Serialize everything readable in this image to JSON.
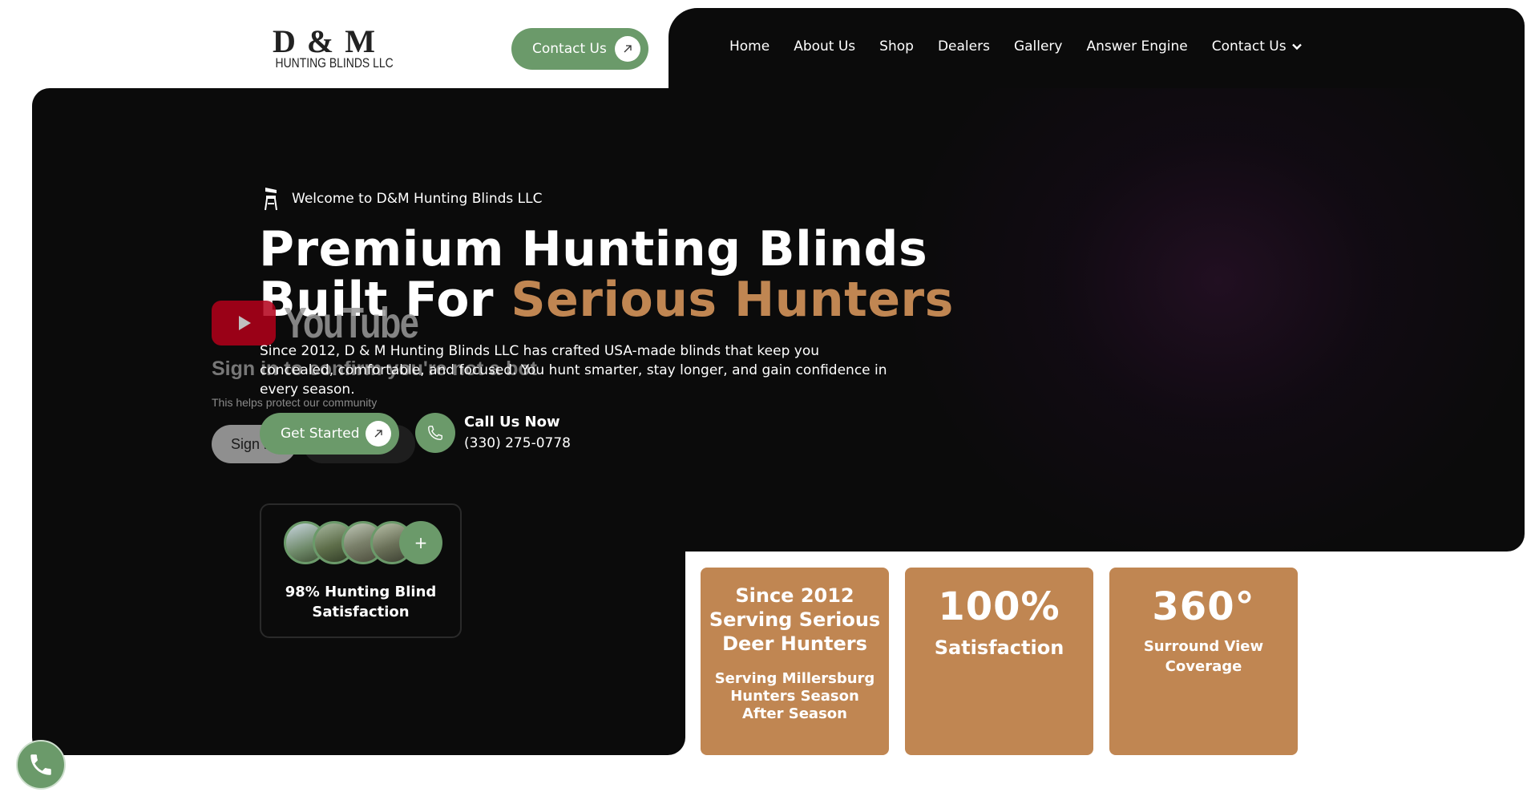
{
  "logo": {
    "main": "D & M",
    "sub": "HUNTING BLINDS LLC"
  },
  "header": {
    "contact_button": "Contact Us"
  },
  "nav": {
    "items": [
      {
        "label": "Home"
      },
      {
        "label": "About Us"
      },
      {
        "label": "Shop"
      },
      {
        "label": "Dealers"
      },
      {
        "label": "Gallery"
      },
      {
        "label": "Answer Engine"
      },
      {
        "label": "Contact Us"
      }
    ]
  },
  "hero": {
    "welcome": "Welcome to D&M Hunting Blinds LLC",
    "headline_line1": "Premium Hunting Blinds",
    "headline_line2_plain": "Built For ",
    "headline_line2_accent": "Serious Hunters",
    "description": "Since 2012, D & M Hunting Blinds LLC has crafted USA-made blinds that keep you concealed, comfortable, and focused. You hunt smarter, stay longer, and gain confidence in every season.",
    "get_started": "Get Started",
    "call_title": "Call Us Now",
    "call_number": "(330) 275-0778"
  },
  "youtube_overlay": {
    "wordmark": "YouTube",
    "signin_title": "Sign in to confirm you're not a bot",
    "protect_text": "This helps protect our community",
    "signin_button": "Sign in"
  },
  "satisfaction_card": {
    "plus": "+",
    "text": "98% Hunting Blind Satisfaction"
  },
  "stats": [
    {
      "title": "Since 2012 Serving Serious Deer Hunters",
      "subtitle": "Serving Millersburg Hunters Season After Season"
    },
    {
      "number": "100%",
      "label": "Satisfaction"
    },
    {
      "number": "360°",
      "label": "Surround View Coverage"
    }
  ],
  "colors": {
    "accent_green": "#6b9a6a",
    "accent_tan": "#c08652",
    "dark_bg": "#0b0b0b"
  }
}
